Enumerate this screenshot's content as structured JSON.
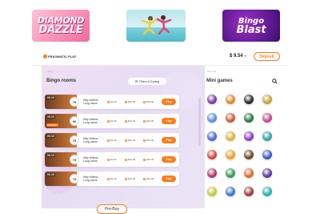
{
  "promos": [
    {
      "name": "diamond-dazzle",
      "line1": "DIAMOND",
      "line2": "DAZZLE"
    },
    {
      "name": "splash-promo"
    },
    {
      "name": "bingo-blast",
      "line1": "Bingo",
      "line2": "Blast"
    }
  ],
  "header": {
    "logo_text": "PRAGMATIC PLAY",
    "balance": "$ 9.54",
    "deposit_label": "Deposit"
  },
  "main": {
    "breadcrumb": "Lobby",
    "section_title": "Bingo rooms",
    "filters_label": "Filters & Sorting",
    "prebuy_label": "Pre-Buy"
  },
  "rooms": [
    {
      "tag": "00:19",
      "ball": "75",
      "name": "Kitty Kittens Long name",
      "stat1": "$1.00",
      "stat2": "$10.00",
      "stat3": "$10.00",
      "play": "Play",
      "badge": ""
    },
    {
      "tag": "00:19",
      "ball": "90",
      "name": "Kitty Kittens Long name",
      "stat1": "$1.00",
      "stat2": "$10.00",
      "stat3": "$10.00",
      "play": "Play",
      "badge": "JACKPOT"
    },
    {
      "tag": "00:19",
      "ball": "75",
      "name": "Kitty Kittens Long name",
      "stat1": "$1.00",
      "stat2": "$10.00",
      "stat3": "$10.00",
      "play": "Play",
      "badge": ""
    },
    {
      "tag": "00:19",
      "ball": "75",
      "name": "Kitty Kittens Long name",
      "stat1": "$1.00",
      "stat2": "$10.00",
      "stat3": "$10.00",
      "play": "Play",
      "badge": ""
    },
    {
      "tag": "00:19",
      "ball": "75",
      "name": "Kitty Kittens Long name",
      "stat1": "$1.00",
      "stat2": "$10.00",
      "stat3": "$10.00",
      "play": "Play",
      "badge": ""
    }
  ],
  "side": {
    "breadcrumb": "Play now",
    "title": "Mini games",
    "search_icon": "search-icon"
  },
  "mini_game_colors": [
    "#7b3fa0",
    "#e08a2a",
    "#2b2b2b",
    "#c9a23a",
    "#5b8fd6",
    "#d25b3a",
    "#2a7a3a",
    "#c44d8b",
    "#4d6bd1",
    "#e0b338",
    "#8a3ad1",
    "#3aa0a8",
    "#d1493a",
    "#f0a030",
    "#6b4a2a",
    "#3a5ad1",
    "#b03a6a",
    "#3a9a5a",
    "#e06a2a",
    "#5a3aa0",
    "#c8c83a",
    "#3a7ad1",
    "#a03a3a",
    "#2ab0b0"
  ]
}
